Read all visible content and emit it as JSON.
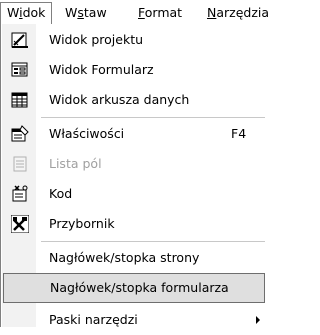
{
  "menubar": {
    "items": [
      {
        "text": "Widok",
        "underline_index": 1
      },
      {
        "text": "Wstaw",
        "underline_index": 1
      },
      {
        "text": "Format",
        "underline_index": 0
      },
      {
        "text": "Narzędzia",
        "underline_index": 0
      }
    ]
  },
  "menu": {
    "items": [
      {
        "label": "Widok projektu",
        "icon": "design-view-icon",
        "disabled": false
      },
      {
        "label": "Widok Formularz",
        "icon": "form-view-icon",
        "disabled": false
      },
      {
        "label": "Widok arkusza danych",
        "icon": "datasheet-view-icon",
        "disabled": false
      },
      {
        "label": "Właściwości",
        "shortcut": "F4",
        "icon": "properties-icon",
        "disabled": false
      },
      {
        "label": "Lista pól",
        "icon": "field-list-icon",
        "disabled": true
      },
      {
        "label": "Kod",
        "icon": "code-icon",
        "disabled": false
      },
      {
        "label": "Przybornik",
        "icon": "toolbox-icon",
        "disabled": false
      },
      {
        "label": "Nagłówek/stopka strony",
        "disabled": false
      },
      {
        "label": "Nagłówek/stopka formularza",
        "disabled": false,
        "highlighted": true
      },
      {
        "label": "Paski narzędzi",
        "disabled": false,
        "submenu": true
      }
    ]
  }
}
